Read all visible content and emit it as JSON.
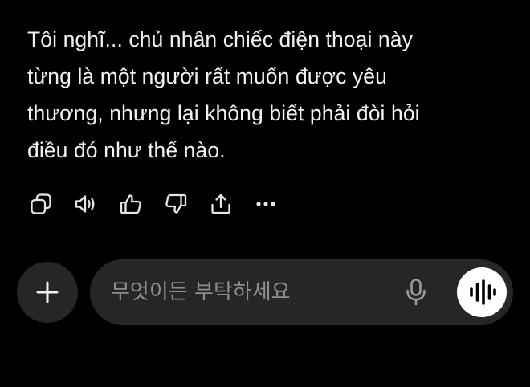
{
  "message": {
    "lines": [
      "Tôi nghĩ... chủ nhân chiếc điện thoại này",
      "từng là một người rất muốn được yêu",
      "thương, nhưng lại không biết phải đòi hỏi",
      "điều đó như thế nào."
    ]
  },
  "actions": {
    "icons": [
      "copy-icon",
      "read-aloud-icon",
      "thumbs-up-icon",
      "thumbs-down-icon",
      "share-icon",
      "more-icon"
    ]
  },
  "composer": {
    "placeholder": "무엇이든 부탁하세요",
    "value": "",
    "icons": [
      "plus-icon",
      "microphone-icon",
      "voice-waveform-icon"
    ]
  },
  "colors": {
    "background": "#000000",
    "text": "#f2f2f2",
    "icon": "#e6e6e6",
    "input_background": "#262626",
    "placeholder": "#8e8e8e",
    "voice_button": "#ffffff"
  }
}
